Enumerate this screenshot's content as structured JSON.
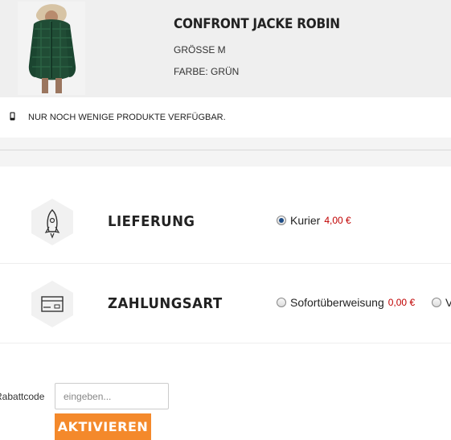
{
  "product": {
    "title": "CONFRONT JACKE ROBIN",
    "size": "GRÖSSE M",
    "color": "FARBE: GRÜN",
    "image_icon": "green-jacket-photo"
  },
  "stock": {
    "icon": "mobile-phone-icon",
    "text": "NUR NOCH WENIGE PRODUKTE VERFÜGBAR."
  },
  "delivery": {
    "icon": "rocket-icon",
    "title": "LIEFERUNG",
    "options": [
      {
        "label": "Kurier",
        "price": "4,00 €",
        "selected": true
      }
    ]
  },
  "payment": {
    "icon": "credit-card-icon",
    "title": "ZAHLUNGSART",
    "options": [
      {
        "label": "Sofortüberweisung",
        "price": "0,00 €",
        "selected": false
      },
      {
        "label": "V",
        "price": "",
        "selected": false
      }
    ]
  },
  "discount": {
    "label": "Rabattcode",
    "placeholder": "eingeben...",
    "button": "AKTIVIEREN"
  },
  "colors": {
    "accent": "#f4892b",
    "price": "#c00000",
    "header_bg": "#efefef"
  }
}
